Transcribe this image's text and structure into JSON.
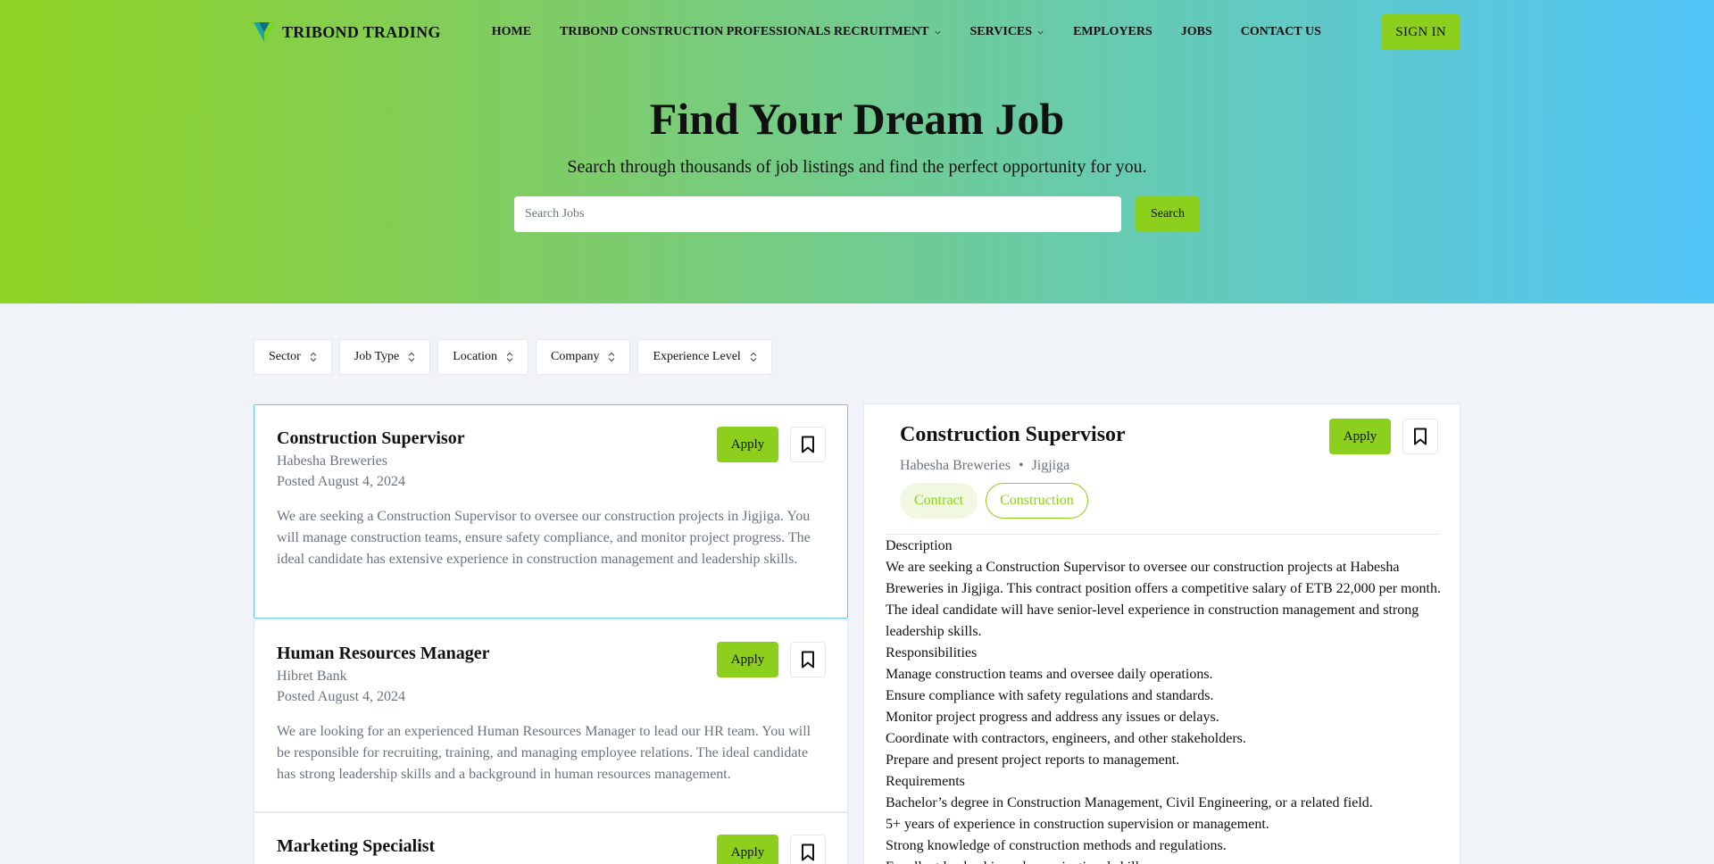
{
  "brand": {
    "name": "TRIBOND TRADING",
    "logo_icon": "chevron-logo-icon",
    "colors": {
      "accent": "#8ccf1c",
      "gradient_start": "#8fd323",
      "gradient_end": "#52c6f9",
      "selected_border": "#6cc5ee"
    }
  },
  "nav": {
    "items": [
      {
        "label": "HOME",
        "dropdown": false
      },
      {
        "label": "TRIBOND CONSTRUCTION PROFESSIONALS RECRUITMENT",
        "dropdown": true
      },
      {
        "label": "SERVICES",
        "dropdown": true
      },
      {
        "label": "EMPLOYERS",
        "dropdown": false
      },
      {
        "label": "JOBS",
        "dropdown": false
      },
      {
        "label": "CONTACT US",
        "dropdown": false
      }
    ],
    "signin_label": "SIGN IN"
  },
  "hero": {
    "title": "Find Your Dream Job",
    "subtitle": "Search through thousands of job listings and find the perfect opportunity for you.",
    "search_placeholder": "Search Jobs",
    "search_value": "",
    "search_button": "Search"
  },
  "filters": [
    {
      "label": "Sector"
    },
    {
      "label": "Job Type"
    },
    {
      "label": "Location"
    },
    {
      "label": "Company"
    },
    {
      "label": "Experience Level"
    }
  ],
  "jobs": [
    {
      "title": "Construction Supervisor",
      "company": "Habesha Breweries",
      "posted": "Posted August 4, 2024",
      "description": "We are seeking a Construction Supervisor to oversee our construction projects in Jigjiga. You will manage construction teams, ensure safety compliance, and monitor project progress. The ideal candidate has extensive experience in construction management and leadership skills.",
      "apply_label": "Apply",
      "selected": true
    },
    {
      "title": "Human Resources Manager",
      "company": "Hibret Bank",
      "posted": "Posted August 4, 2024",
      "description": "We are looking for an experienced Human Resources Manager to lead our HR team. You will be responsible for recruiting, training, and managing employee relations. The ideal candidate has strong leadership skills and a background in human resources management.",
      "apply_label": "Apply",
      "selected": false
    },
    {
      "title": "Marketing Specialist",
      "company": "",
      "posted": "",
      "description": "",
      "apply_label": "Apply",
      "selected": false
    }
  ],
  "detail": {
    "title": "Construction Supervisor",
    "company": "Habesha Breweries",
    "separator": "•",
    "location": "Jigjiga",
    "apply_label": "Apply",
    "tags": [
      {
        "label": "Contract",
        "style": "filled"
      },
      {
        "label": "Construction",
        "style": "outline"
      }
    ],
    "description_heading": "Description",
    "description": "We are seeking a Construction Supervisor to oversee our construction projects at Habesha Breweries in Jigjiga. This contract position offers a competitive salary of ETB 22,000 per month. The ideal candidate will have senior-level experience in construction management and strong leadership skills.",
    "responsibilities_heading": "Responsibilities",
    "responsibilities": [
      "Manage construction teams and oversee daily operations.",
      "Ensure compliance with safety regulations and standards.",
      "Monitor project progress and address any issues or delays.",
      "Coordinate with contractors, engineers, and other stakeholders.",
      "Prepare and present project reports to management."
    ],
    "requirements_heading": "Requirements",
    "requirements": [
      "Bachelor’s degree in Construction Management, Civil Engineering, or a related field.",
      "5+ years of experience in construction supervision or management.",
      "Strong knowledge of construction methods and regulations.",
      "Excellent leadership and organizational skills."
    ]
  }
}
